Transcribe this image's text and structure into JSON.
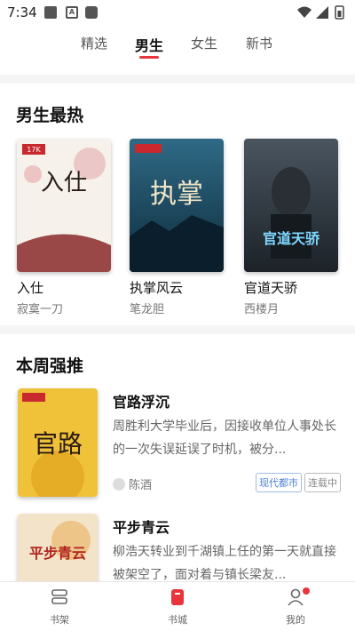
{
  "status_bar": {
    "time": "7:34"
  },
  "top_tabs": [
    {
      "label": "精选",
      "active": false
    },
    {
      "label": "男生",
      "active": true
    },
    {
      "label": "女生",
      "active": false
    },
    {
      "label": "新书",
      "active": false
    }
  ],
  "hot_section": {
    "title": "男生最热",
    "books": [
      {
        "title": "入仕",
        "author": "寂寞一刀",
        "cover_text": "入仕"
      },
      {
        "title": "执掌风云",
        "author": "笔龙胆",
        "cover_text": "执掌"
      },
      {
        "title": "官道天骄",
        "author": "西楼月",
        "cover_text": "官道天骄"
      }
    ]
  },
  "week_section": {
    "title": "本周强推",
    "items": [
      {
        "title": "官路浮沉",
        "desc": "周胜利大学毕业后，因接收单位人事处长的一次失误延误了时机，被分...",
        "author": "陈酒",
        "tags": [
          "现代都市",
          "连载中"
        ],
        "cover_text": "官路"
      },
      {
        "title": "平步青云",
        "desc": "柳浩天转业到千湖镇上任的第一天就直接被架空了，面对着与镇长梁友...",
        "author": "",
        "tags": [],
        "cover_text": "平步青云"
      }
    ]
  },
  "bottom_nav": [
    {
      "label": "书架",
      "icon": "bookshelf-icon",
      "active": false
    },
    {
      "label": "书城",
      "icon": "bookstore-icon",
      "active": true
    },
    {
      "label": "我的",
      "icon": "profile-icon",
      "active": false
    }
  ],
  "colors": {
    "accent": "#e8343a",
    "tag_blue": "#4a7fd6"
  }
}
